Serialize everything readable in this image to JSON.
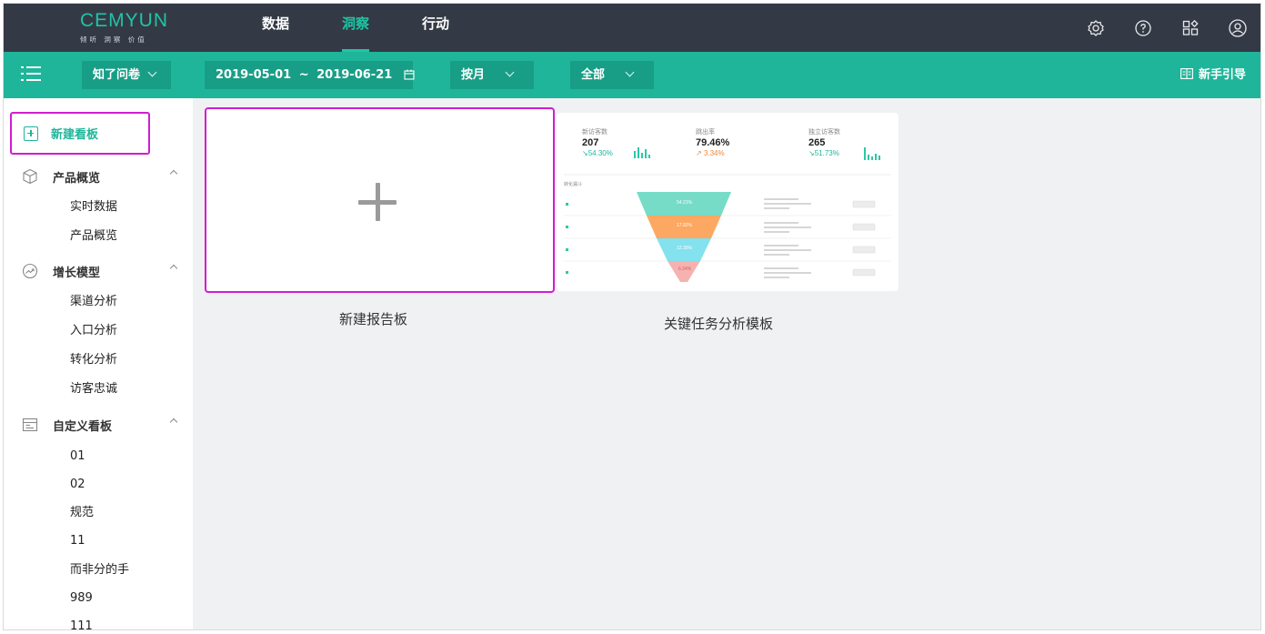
{
  "brand": {
    "name": "CEMYUN",
    "tagline": "倾听 洞察 价值",
    "accent": "#1fc4a6"
  },
  "topnav": {
    "tabs": [
      "数据",
      "洞察",
      "行动"
    ],
    "active": "洞察"
  },
  "top_icons": [
    "settings-icon",
    "help-icon",
    "apps-icon",
    "user-icon"
  ],
  "filters": {
    "survey": "知了问卷",
    "date_start": "2019-05-01",
    "date_sep": "~",
    "date_end": "2019-06-21",
    "granularity": "按月",
    "scope": "全部"
  },
  "guide_label": "新手引导",
  "sidebar": {
    "new_board": "新建看板",
    "groups": [
      {
        "label": "产品概览",
        "icon": "cube-icon",
        "items": [
          "实时数据",
          "产品概览"
        ]
      },
      {
        "label": "增长模型",
        "icon": "growth-icon",
        "items": [
          "渠道分析",
          "入口分析",
          "转化分析",
          "访客忠诚"
        ]
      },
      {
        "label": "自定义看板",
        "icon": "board-icon",
        "items": [
          "01",
          "02",
          "规范",
          "11",
          "而非分的手",
          "989",
          "111"
        ]
      }
    ]
  },
  "cards": {
    "new_report": "新建报告板",
    "template": "关键任务分析模板"
  },
  "template_preview": {
    "kpis": [
      {
        "title": "新访客数",
        "value": "207",
        "change": "54.30%",
        "trend": "down"
      },
      {
        "title": "跳出率",
        "value": "79.46%",
        "change": "3.34%",
        "trend": "up"
      },
      {
        "title": "独立访客数",
        "value": "265",
        "change": "51.73%",
        "trend": "down"
      }
    ],
    "funnel_title": "转化漏斗",
    "funnel_values": [
      "54.21%",
      "17.92%",
      "12.35%",
      "6.34%"
    ]
  }
}
